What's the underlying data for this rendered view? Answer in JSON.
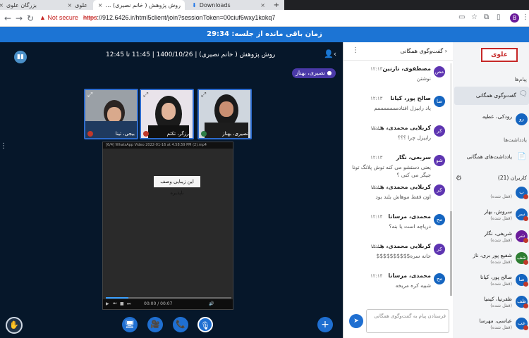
{
  "browser": {
    "tabs": [
      {
        "title": "بزرگان علوی",
        "close": "×"
      },
      {
        "title": "علوی",
        "close": "×"
      },
      {
        "title": "روش پژوهش ( خانم نصیری) …",
        "close": "×"
      },
      {
        "title": "Downloads",
        "close": "×"
      }
    ],
    "new_tab": "+",
    "security_label": "Not secure",
    "url_scheme": "https",
    "url_rest": "://912.6426.ir/html5client/join?sessionToken=00ciuf6wxy1kokq7",
    "profile_letter": "B"
  },
  "session": {
    "timer_text": "زمان باقی مانده از جلسه: 29:34"
  },
  "meeting": {
    "title": "روش پژوهش ( خانم نصیری) | 1400/10/26 | 11:45 تا 12:45",
    "presenter_badge": "نصیری، بهناز",
    "tiles": [
      {
        "name": "بیجی، تینا",
        "mic": "muted"
      },
      {
        "name": "برزگر، تکتم",
        "mic": "muted"
      },
      {
        "name": "نصیری، بهناز",
        "mic": "on"
      }
    ],
    "video": {
      "player_title": "[6/4] WhatsApp Video 2022-01-16 at 4.58.59 PM (2).mp4",
      "caption": "این زیبایی وصف ناپذیره",
      "time": "00:00 / 00:07",
      "progress": 0.18
    }
  },
  "toolbar": {
    "raise_hand_icon": "✋",
    "screen_icon": "🖥",
    "camera_icon": "🎥",
    "phone_icon": "📞",
    "mic_icon": "🎙",
    "plus_icon": "+"
  },
  "chat": {
    "title": "گفت‌وگوی همگانی",
    "back_icon": "‹",
    "messages": [
      {
        "initials": "مص",
        "color": "#5e35b1",
        "name": "مصطفوی، نازنین",
        "time": "۱۲:۱۳",
        "text": "نوشتن"
      },
      {
        "initials": "صا",
        "color": "#1565c0",
        "name": "صالح پور، کیانا",
        "time": "۱۲:۱۳",
        "text": "یاد رابیزل افتادمممممممم"
      },
      {
        "initials": "کر",
        "color": "#5e35b1",
        "name": "کربلایی محمدی، هـ...",
        "time": "۱۲:۱۳",
        "text": "رابیزل چرا ؟؟؟"
      },
      {
        "initials": "شو",
        "color": "#5e35b1",
        "name": "سربعی، نگار",
        "time": "۱۲:۱۳",
        "text": "یعنی دستشو می کنه توش پلانگ تونا جیگر می کنی ؟"
      },
      {
        "initials": "کر",
        "color": "#5e35b1",
        "name": "کربلایی محمدی، هـ...",
        "time": "۱۲:۱۳",
        "text": "اون فقط موهاش بلند بود"
      },
      {
        "initials": "مح",
        "color": "#1565c0",
        "name": "محمدی، مرسانا",
        "time": "۱۲:۱۴",
        "text": "دریاچه است یا بنه؟"
      },
      {
        "initials": "کر",
        "color": "#5e35b1",
        "name": "کربلایی محمدی، هـ...",
        "time": "۱۲:۱۴",
        "text": "حانه سره$$$$$$$$$$"
      },
      {
        "initials": "مح",
        "color": "#1565c0",
        "name": "محمدی، مرسانا",
        "time": "۱۲:۱۴",
        "text": "شبیه کره مریخه"
      }
    ],
    "input_placeholder": "فرستادن پیام به گفت‌وگوی همگانی",
    "send_icon": "➤"
  },
  "sidebar": {
    "logo_text": "علوی",
    "messages_heading": "پیام‌ها",
    "public_chat_label": "گفت‌وگوی همگانی",
    "private_chats": [
      {
        "initials": "رو",
        "color": "#1565c0",
        "name": "رودکی، عطیه"
      }
    ],
    "notes_heading": "یادداشت‌ها",
    "shared_notes_label": "یادداشت‌های همگانی",
    "users_heading": "کاربران (21)",
    "users": [
      {
        "initials": "ب",
        "color": "#1565c0",
        "name": "",
        "status": "(قفل شده)"
      },
      {
        "initials": "سر",
        "color": "#1565c0",
        "name": "سروش، بهار",
        "status": "(قفل شده)"
      },
      {
        "initials": "شر",
        "color": "#6a1b9a",
        "name": "شریفی، نگار",
        "status": "(قفل شده)"
      },
      {
        "initials": "شف",
        "color": "#2e7d32",
        "name": "شفیع پور بری، ناز",
        "status": "(قفل شده)"
      },
      {
        "initials": "صا",
        "color": "#1565c0",
        "name": "صالح پور، کیانا",
        "status": "(قفل شده)"
      },
      {
        "initials": "ظف",
        "color": "#1565c0",
        "name": "ظفرنیا، کیمیا",
        "status": "(قفل شده)"
      },
      {
        "initials": "عب",
        "color": "#1565c0",
        "name": "عباسی، مهرسا",
        "status": "(قفل شده)"
      }
    ]
  }
}
